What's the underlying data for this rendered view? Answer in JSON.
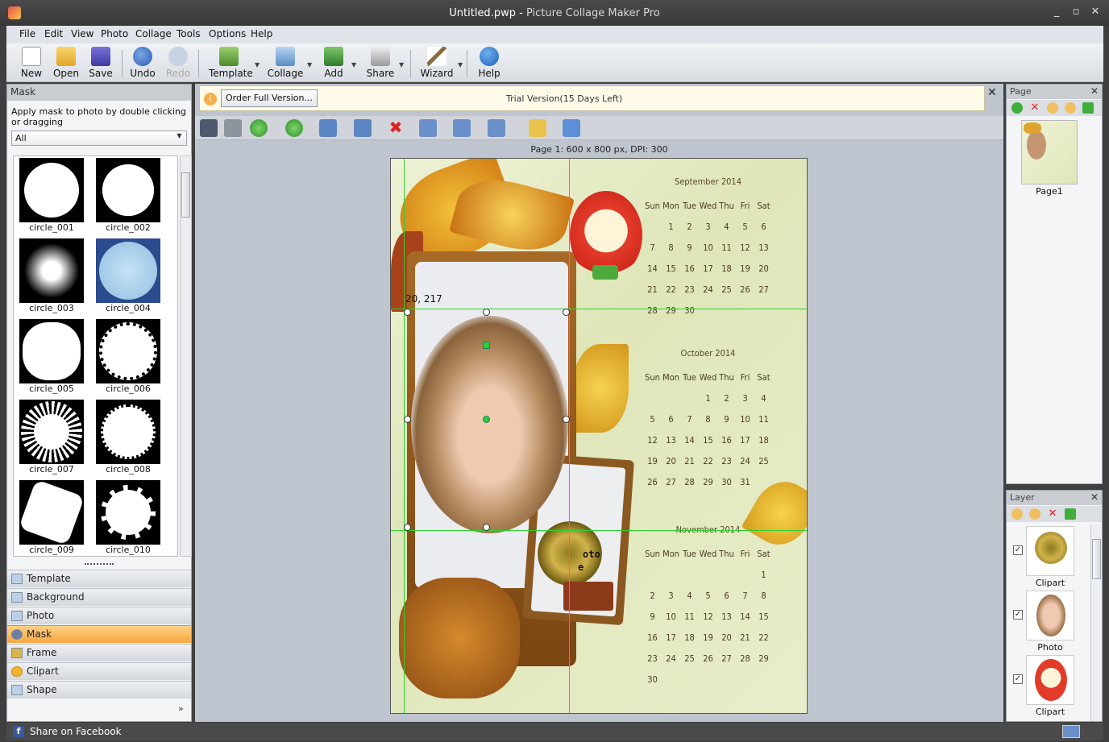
{
  "window": {
    "file": "Untitled.pwp",
    "sep": " - ",
    "app": "Picture Collage Maker Pro",
    "min": "_",
    "max": "▫",
    "close": "✕"
  },
  "menu": [
    "File",
    "Edit",
    "View",
    "Photo",
    "Collage",
    "Tools",
    "Options",
    "Help"
  ],
  "toolbar": {
    "new": "New",
    "open": "Open",
    "save": "Save",
    "undo": "Undo",
    "redo": "Redo",
    "template": "Template",
    "collage": "Collage",
    "add": "Add",
    "share": "Share",
    "wizard": "Wizard",
    "help": "Help"
  },
  "left": {
    "header": "Mask",
    "hint": "Apply mask to photo by double clicking or dragging",
    "filter": "All",
    "masks": [
      "circle_001",
      "circle_002",
      "circle_003",
      "circle_004",
      "circle_005",
      "circle_006",
      "circle_007",
      "circle_008",
      "circle_009",
      "circle_010"
    ],
    "nav": [
      "Template",
      "Background",
      "Photo",
      "Mask",
      "Frame",
      "Clipart",
      "Shape"
    ],
    "more": "»"
  },
  "trial": {
    "order": "Order Full Version...",
    "text": "Trial Version(15 Days Left)",
    "close": "✕"
  },
  "pageinfo": "Page 1: 600 x 800 px, DPI: 300",
  "coords": "20, 217",
  "photo_text": "oto",
  "photo_text2": "e",
  "calendar": {
    "days": [
      "Sun",
      "Mon",
      "Tue",
      "Wed",
      "Thu",
      "Fri",
      "Sat"
    ],
    "months": [
      {
        "title": "September   2014",
        "weeks": [
          [
            "",
            "1",
            "2",
            "3",
            "4",
            "5",
            "6"
          ],
          [
            "7",
            "8",
            "9",
            "10",
            "11",
            "12",
            "13"
          ],
          [
            "14",
            "15",
            "16",
            "17",
            "18",
            "19",
            "20"
          ],
          [
            "21",
            "22",
            "23",
            "24",
            "25",
            "26",
            "27"
          ],
          [
            "28",
            "29",
            "30",
            "",
            "",
            "",
            ""
          ]
        ]
      },
      {
        "title": "October   2014",
        "weeks": [
          [
            "",
            "",
            "",
            "1",
            "2",
            "3",
            "4"
          ],
          [
            "5",
            "6",
            "7",
            "8",
            "9",
            "10",
            "11"
          ],
          [
            "12",
            "13",
            "14",
            "15",
            "16",
            "17",
            "18"
          ],
          [
            "19",
            "20",
            "21",
            "22",
            "23",
            "24",
            "25"
          ],
          [
            "26",
            "27",
            "28",
            "29",
            "30",
            "31",
            ""
          ]
        ]
      },
      {
        "title": "November   2014",
        "weeks": [
          [
            "",
            "",
            "",
            "",
            "",
            "",
            "1"
          ],
          [
            "2",
            "3",
            "4",
            "5",
            "6",
            "7",
            "8"
          ],
          [
            "9",
            "10",
            "11",
            "12",
            "13",
            "14",
            "15"
          ],
          [
            "16",
            "17",
            "18",
            "19",
            "20",
            "21",
            "22"
          ],
          [
            "23",
            "24",
            "25",
            "26",
            "27",
            "28",
            "29"
          ],
          [
            "30",
            "",
            "",
            "",
            "",
            "",
            ""
          ]
        ]
      }
    ]
  },
  "pagepanel": {
    "header": "Page",
    "close": "✕",
    "page1": "Page1"
  },
  "layerpanel": {
    "header": "Layer",
    "close": "✕",
    "layers": [
      {
        "label": "Clipart",
        "checked": "✓"
      },
      {
        "label": "Photo",
        "checked": "✓"
      },
      {
        "label": "Clipart",
        "checked": "✓"
      }
    ]
  },
  "status": {
    "facebook": "Share on Facebook"
  }
}
